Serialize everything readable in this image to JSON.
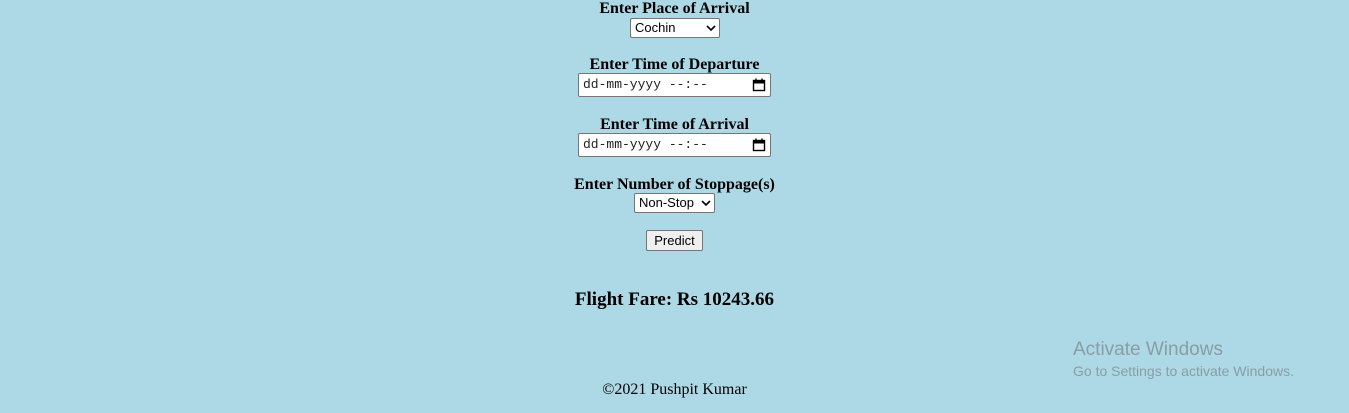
{
  "form": {
    "arrival_place_label": "Enter Place of Arrival",
    "arrival_place_value": "Cochin",
    "departure_time_label": "Enter Time of Departure",
    "departure_time_placeholder": "dd-mm-yyyy --:--",
    "arrival_time_label": "Enter Time of Arrival",
    "arrival_time_placeholder": "dd-mm-yyyy --:--",
    "stoppage_label": "Enter Number of Stoppage(s)",
    "stoppage_value": "Non-Stop",
    "predict_button": "Predict"
  },
  "result": {
    "text": "Flight Fare: Rs 10243.66"
  },
  "footer": {
    "text": "©2021 Pushpit Kumar"
  },
  "watermark": {
    "title": "Activate Windows",
    "subtitle": "Go to Settings to activate Windows."
  },
  "colors": {
    "background": "#add8e6"
  },
  "icons": {
    "select_arrow": "chevron-down-icon",
    "date_picker": "calendar-icon"
  }
}
